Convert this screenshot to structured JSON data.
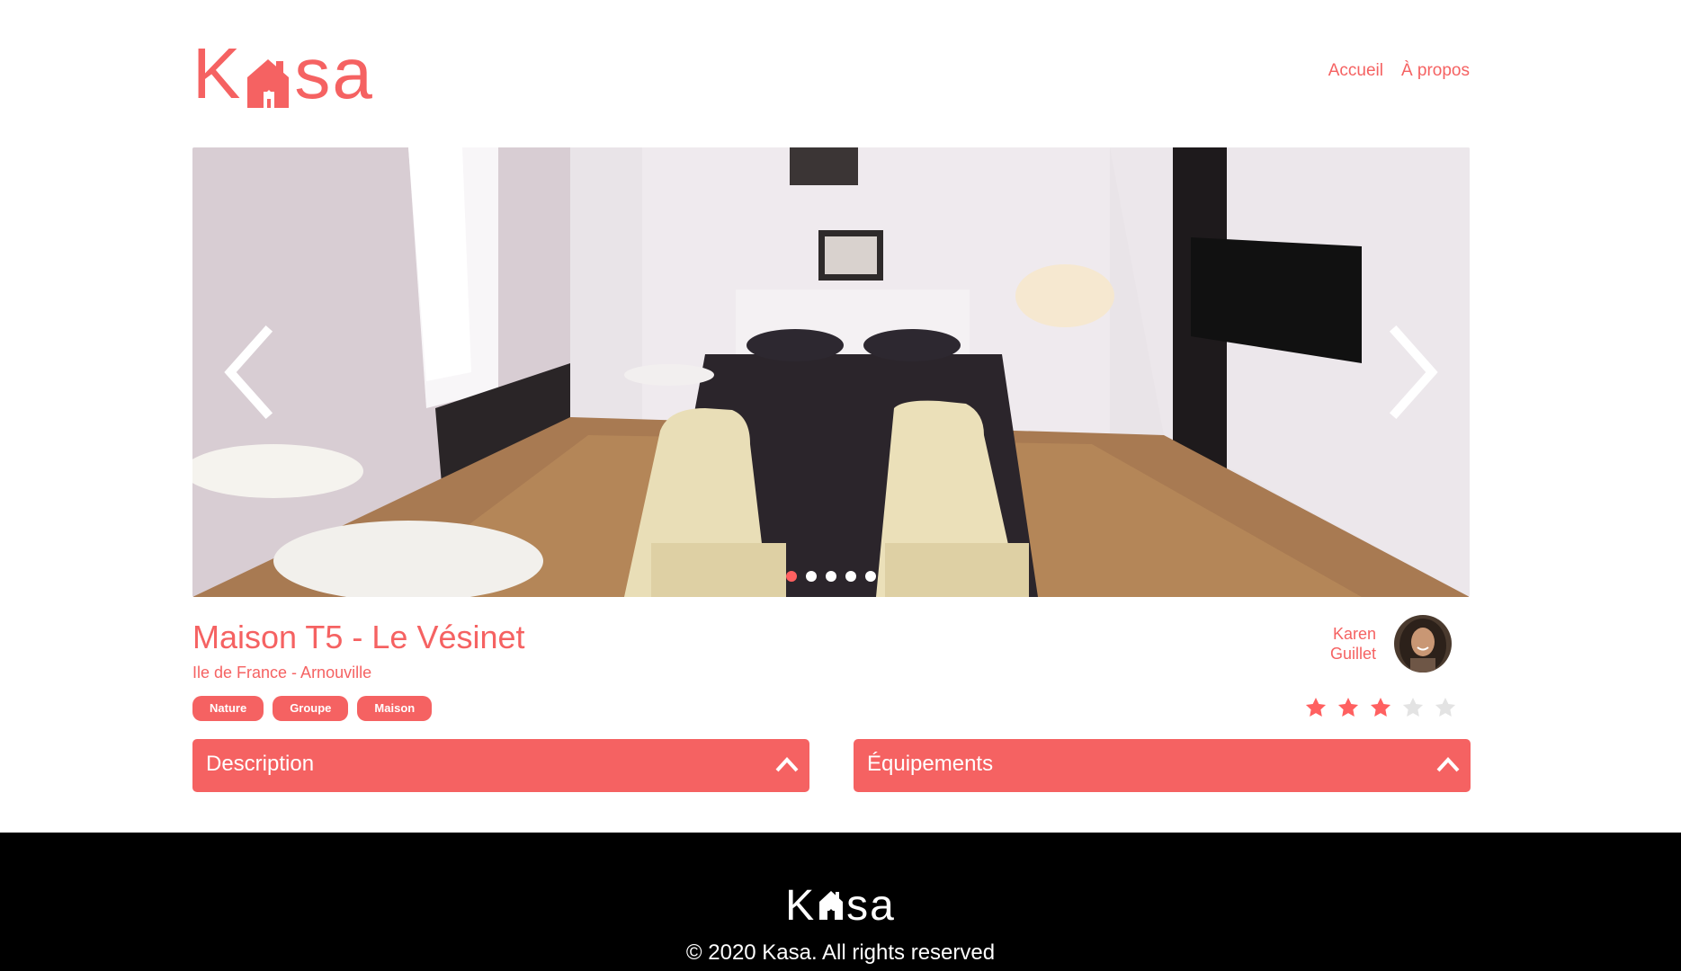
{
  "header": {
    "logo_left": "K",
    "logo_right": "sa",
    "nav": [
      {
        "label": "Accueil"
      },
      {
        "label": "À propos"
      }
    ]
  },
  "slideshow": {
    "slide_count": 5,
    "current_index": 0
  },
  "listing": {
    "title": "Maison T5 - Le Vésinet",
    "location": "Ile de France - Arnouville",
    "tags": [
      "Nature",
      "Groupe",
      "Maison"
    ],
    "host": {
      "first_name": "Karen",
      "last_name": "Guillet"
    },
    "rating": 3,
    "rating_max": 5
  },
  "collapses": {
    "description": {
      "title": "Description"
    },
    "equipments": {
      "title": "Équipements"
    }
  },
  "footer": {
    "logo_left": "K",
    "logo_right": "sa",
    "copyright": "© 2020 Kasa. All rights reserved"
  },
  "colors": {
    "brand": "#FF6060",
    "star_off": "#E3E3E3",
    "footer_bg": "#000000"
  }
}
